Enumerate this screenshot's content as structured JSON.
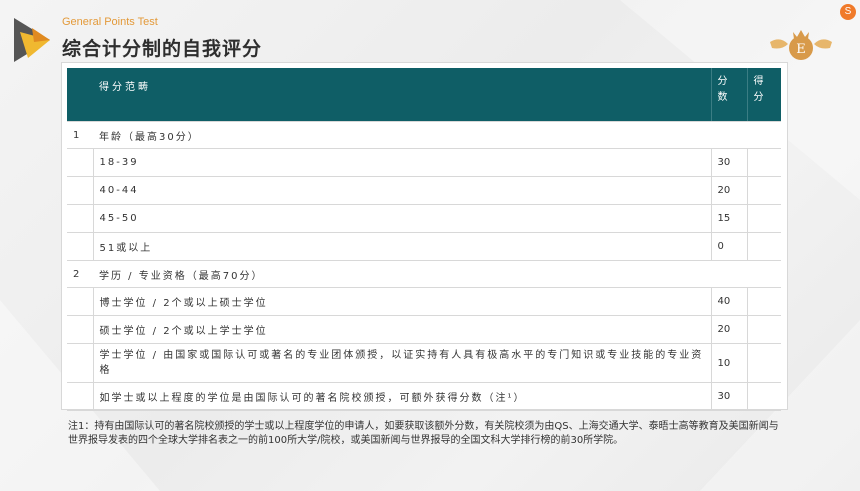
{
  "header": {
    "subtitle": "General Points Test",
    "title": "综合计分制的自我评分"
  },
  "badge": {
    "label": "S",
    "color": "#f07a2a"
  },
  "colors": {
    "header_bg": "#0f5e66",
    "accent": "#e39a3a"
  },
  "table": {
    "headers": {
      "range": "得分范畴",
      "points": "分数",
      "score": "得分"
    },
    "rows": [
      {
        "kind": "category",
        "num": "1",
        "label": "年龄（最高30分）",
        "points": ""
      },
      {
        "kind": "sub",
        "label": "18-39",
        "points": "30"
      },
      {
        "kind": "sub",
        "label": "40-44",
        "points": "20"
      },
      {
        "kind": "sub",
        "label": "45-50",
        "points": "15"
      },
      {
        "kind": "sub",
        "label": "51或以上",
        "points": "0"
      },
      {
        "kind": "category",
        "num": "2",
        "label": "学历 / 专业资格（最高70分）",
        "points": ""
      },
      {
        "kind": "sub",
        "label": "博士学位 / 2个或以上硕士学位",
        "points": "40"
      },
      {
        "kind": "sub",
        "label": "硕士学位 / 2个或以上学士学位",
        "points": "20"
      },
      {
        "kind": "tall",
        "label": "学士学位 / 由国家或国际认可或著名的专业团体颁授，以证实持有人具有极高水平的专门知识或专业技能的专业资格",
        "points": "10"
      },
      {
        "kind": "sub",
        "label": "如学士或以上程度的学位是由国际认可的著名院校颁授，可额外获得分数（注¹）",
        "points": "30"
      }
    ]
  },
  "note": "注1：持有由国际认可的著名院校颁授的学士或以上程度学位的申请人，如要获取该额外分数，有关院校须为由QS、上海交通大学、泰晤士高等教育及美国新闻与世界报导发表的四个全球大学排名表之一的前100所大学/院校，或美国新闻与世界报导的全国文科大学排行榜的前30所学院。"
}
